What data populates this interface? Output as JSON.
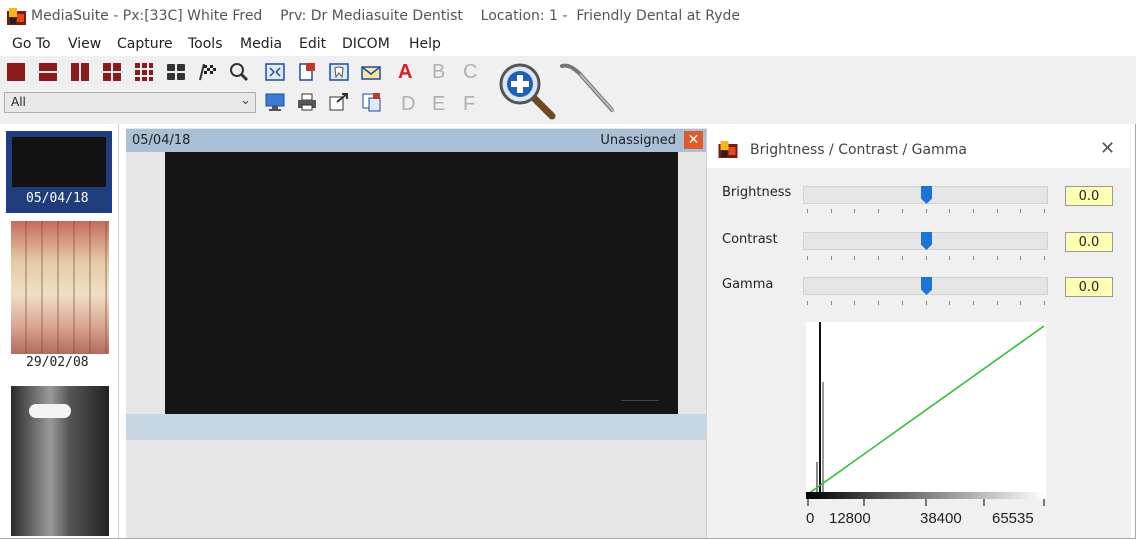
{
  "titlebar": {
    "app": "MediaSuite",
    "patient": "Px:[33C] White Fred",
    "provider": "Prv: Dr Mediasuite Dentist",
    "location": "Location: 1 -  Friendly Dental at Ryde"
  },
  "menu": [
    "Go To",
    "View",
    "Capture",
    "Tools",
    "Media",
    "Edit",
    "DICOM",
    "Help"
  ],
  "toolbar": {
    "letters_row1": [
      "A",
      "B",
      "C"
    ],
    "letters_row2": [
      "D",
      "E",
      "F"
    ],
    "filter_value": "All"
  },
  "thumbnails": [
    {
      "date": "05/04/18",
      "selected": true
    },
    {
      "date": "29/02/08",
      "selected": false
    },
    {
      "date": "",
      "selected": false
    }
  ],
  "viewer": {
    "date": "05/04/18",
    "status": "Unassigned"
  },
  "dialog": {
    "title": "Brightness / Contrast / Gamma",
    "brightness_label": "Brightness",
    "brightness_value": "0.0",
    "contrast_label": "Contrast",
    "contrast_value": "0.0",
    "gamma_label": "Gamma",
    "gamma_value": "0.0",
    "slider_levels": [
      0.5,
      0.5,
      0.5
    ],
    "histogram_axis": [
      "0",
      "12800",
      "38400",
      "65535"
    ]
  },
  "colors": {
    "accent_blue": "#1c74d9",
    "value_bg": "#ffffb4",
    "curve_green": "#2dbb2d",
    "close_orange": "#e05a2b"
  }
}
